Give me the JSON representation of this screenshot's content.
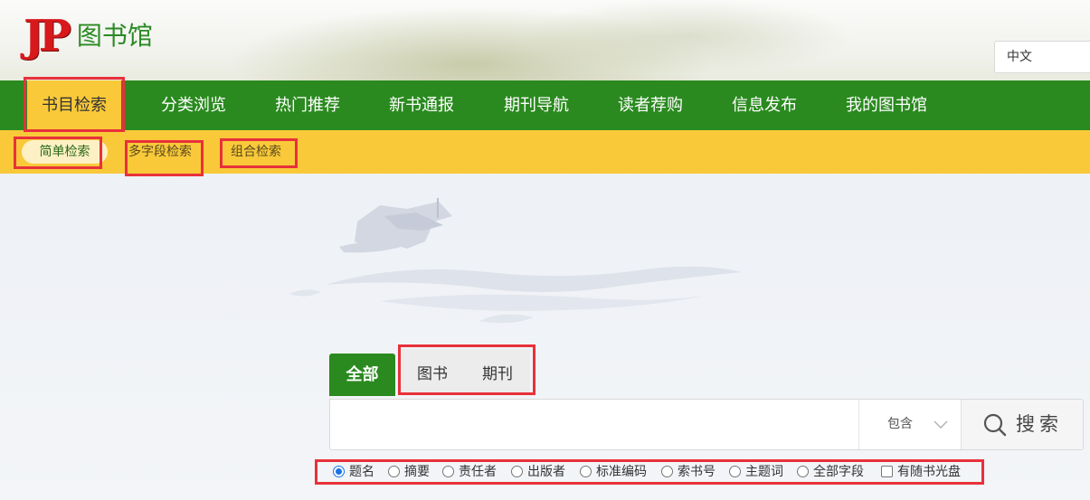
{
  "header": {
    "logo_mark": "JP",
    "logo_text": "图书馆",
    "language": "中文"
  },
  "main_nav": {
    "items": [
      {
        "label": "书目检索",
        "active": true
      },
      {
        "label": "分类浏览"
      },
      {
        "label": "热门推荐"
      },
      {
        "label": "新书通报"
      },
      {
        "label": "期刊导航"
      },
      {
        "label": "读者荐购"
      },
      {
        "label": "信息发布"
      },
      {
        "label": "我的图书馆"
      }
    ]
  },
  "sub_nav": {
    "items": [
      {
        "label": "简单检索",
        "active": true
      },
      {
        "label": "多字段检索"
      },
      {
        "label": "组合检索"
      }
    ]
  },
  "search": {
    "tabs": [
      {
        "label": "全部",
        "active": true
      },
      {
        "label": "图书"
      },
      {
        "label": "期刊"
      }
    ],
    "query": "",
    "match_mode": "包含",
    "button_label": "搜索",
    "fields": [
      {
        "label": "题名",
        "type": "radio",
        "checked": true
      },
      {
        "label": "摘要",
        "type": "radio"
      },
      {
        "label": "责任者",
        "type": "radio"
      },
      {
        "label": "出版者",
        "type": "radio"
      },
      {
        "label": "标准编码",
        "type": "radio"
      },
      {
        "label": "索书号",
        "type": "radio"
      },
      {
        "label": "主题词",
        "type": "radio"
      },
      {
        "label": "全部字段",
        "type": "radio"
      },
      {
        "label": "有随书光盘",
        "type": "checkbox"
      }
    ]
  },
  "colors": {
    "nav_green": "#2a8a1f",
    "accent_yellow": "#f9c93a",
    "logo_red": "#d7191c",
    "highlight_red": "#e8313a"
  }
}
